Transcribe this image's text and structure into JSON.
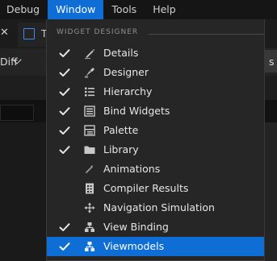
{
  "menubar": {
    "items": [
      {
        "label": "Debug",
        "active": false
      },
      {
        "label": "Window",
        "active": true
      },
      {
        "label": "Tools",
        "active": false
      },
      {
        "label": "Help",
        "active": false
      }
    ]
  },
  "background": {
    "tab_label": "T",
    "toolbar_button_label": "Diff",
    "right_button_label": "s"
  },
  "dropdown": {
    "section_title": "WIDGET DESIGNER",
    "items": [
      {
        "label": "Details",
        "checked": true,
        "icon": "pencil-icon"
      },
      {
        "label": "Designer",
        "checked": true,
        "icon": "designer-icon"
      },
      {
        "label": "Hierarchy",
        "checked": true,
        "icon": "hierarchy-icon"
      },
      {
        "label": "Bind Widgets",
        "checked": true,
        "icon": "bind-widgets-icon"
      },
      {
        "label": "Palette",
        "checked": true,
        "icon": "palette-icon"
      },
      {
        "label": "Library",
        "checked": true,
        "icon": "folder-icon"
      },
      {
        "label": "Animations",
        "checked": false,
        "icon": "animation-icon"
      },
      {
        "label": "Compiler Results",
        "checked": false,
        "icon": "compiler-results-icon"
      },
      {
        "label": "Navigation Simulation",
        "checked": false,
        "icon": "navigation-icon"
      },
      {
        "label": "View Binding",
        "checked": true,
        "icon": "view-binding-icon"
      },
      {
        "label": "Viewmodels",
        "checked": true,
        "icon": "viewmodels-icon",
        "highlighted": true
      }
    ]
  },
  "colors": {
    "accent": "#0e6ed6",
    "menu_bg": "#262626",
    "text": "#e6e6e6",
    "icon": "#c8c8c8",
    "secondary_icon": "#9a9a9a"
  }
}
